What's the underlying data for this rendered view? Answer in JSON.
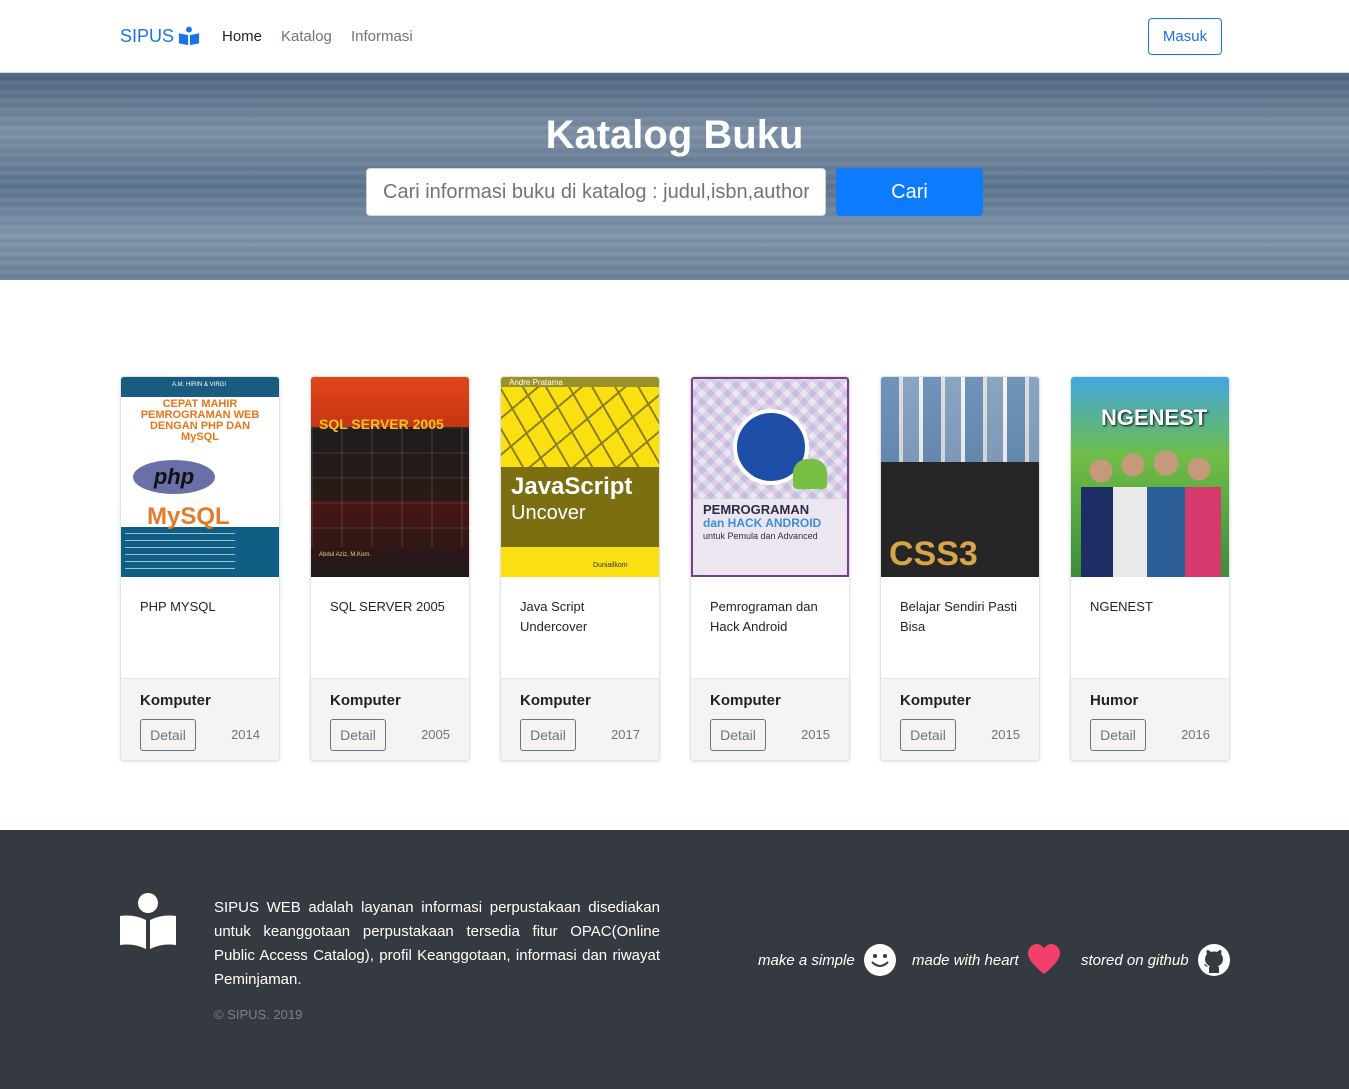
{
  "brand": {
    "name": "SIPUS",
    "icon": "reader-icon",
    "color": "#1a73e8"
  },
  "nav": {
    "home": "Home",
    "catalog": "Katalog",
    "info": "Informasi"
  },
  "login": {
    "label": "Masuk"
  },
  "hero": {
    "title": "Katalog Buku",
    "search_placeholder": "Cari informasi buku di katalog : judul,isbn,author",
    "search_button": "Cari"
  },
  "books": [
    {
      "title": "PHP MYSQL",
      "category": "Komputer",
      "detail": "Detail",
      "year": "2014",
      "cover": {
        "top": "A.M. HIRIN & VIRGI",
        "title": "CEPAT MAHIR PEMROGRAMAN WEB DENGAN PHP DAN MySQL",
        "logo1": "php",
        "logo2": "MySQL"
      }
    },
    {
      "title": "SQL SERVER 2005",
      "category": "Komputer",
      "detail": "Detail",
      "year": "2005",
      "cover": {
        "title": "SQL SERVER 2005",
        "author": "Abdul Aziz, M.Kom."
      }
    },
    {
      "title": "Java Script Undercover",
      "category": "Komputer",
      "detail": "Detail",
      "year": "2017",
      "cover": {
        "top": "Andre Pratama",
        "line1": "JavaScript",
        "line2": "Uncover",
        "foot": "Duniailkom"
      }
    },
    {
      "title": "Pemrograman dan Hack Android",
      "category": "Komputer",
      "detail": "Detail",
      "year": "2015",
      "cover": {
        "line1": "PEMROGRAMAN",
        "line2": "dan HACK ANDROID",
        "line3": "untuk Pemula dan Advanced"
      }
    },
    {
      "title": "Belajar Sendiri Pasti Bisa",
      "category": "Komputer",
      "detail": "Detail",
      "year": "2015",
      "cover": {
        "title": "CSS3"
      }
    },
    {
      "title": "NGENEST",
      "category": "Humor",
      "detail": "Detail",
      "year": "2016",
      "cover": {
        "title": "NGENEST"
      }
    }
  ],
  "footer": {
    "description": "SIPUS WEB adalah layanan informasi perpustakaan disediakan untuk keanggotaan perpustakaan tersedia fitur OPAC(Online Public Access Catalog), profil Keanggotaan, informasi dan riwayat Peminjaman.",
    "copyright": "© SIPUS. 2019",
    "items": [
      {
        "label": "make a simple",
        "icon": "smile-icon"
      },
      {
        "label": "made with heart",
        "icon": "heart-icon",
        "color": "#f2406a"
      },
      {
        "label": "stored on github",
        "icon": "github-icon"
      }
    ]
  }
}
